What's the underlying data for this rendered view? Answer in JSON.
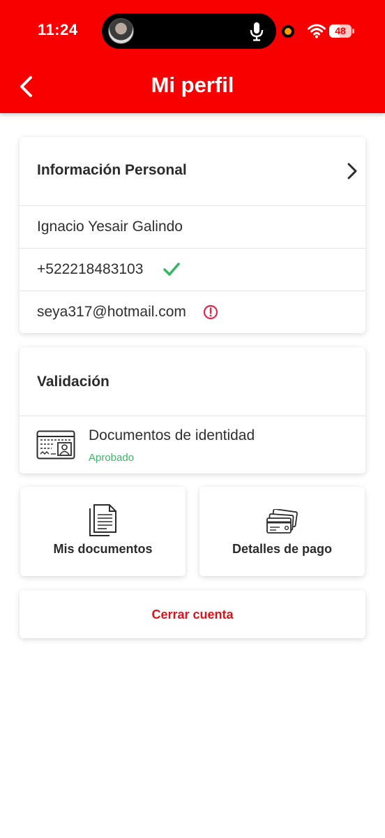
{
  "status_bar": {
    "time": "11:24",
    "battery_level": "48",
    "icons": [
      "avatar",
      "microphone-icon",
      "recording-indicator",
      "wifi-icon",
      "battery-icon"
    ]
  },
  "header": {
    "title": "Mi perfil",
    "back_icon": "chevron-left-icon",
    "background_color": "#f90000"
  },
  "personal_info": {
    "title": "Información Personal",
    "chevron_icon": "chevron-right-icon",
    "name": "Ignacio Yesair Galindo",
    "phone": "+522218483103",
    "phone_status_icon": "check-icon",
    "email": "seya317@hotmail.com",
    "email_status_icon": "alert-circle-icon"
  },
  "validation": {
    "title": "Validación",
    "document_icon": "id-card-icon",
    "document_label": "Documentos de identidad",
    "document_status": "Aprobado"
  },
  "actions": {
    "documents_label": "Mis documentos",
    "documents_icon": "documents-icon",
    "payment_label": "Detalles de pago",
    "payment_icon": "credit-cards-icon",
    "logout_label": "Cerrar cuenta"
  },
  "colors": {
    "brand_red": "#f90000",
    "success_green": "#3cb46a",
    "alert_red": "#e0284f",
    "logout_red": "#d8141c"
  }
}
